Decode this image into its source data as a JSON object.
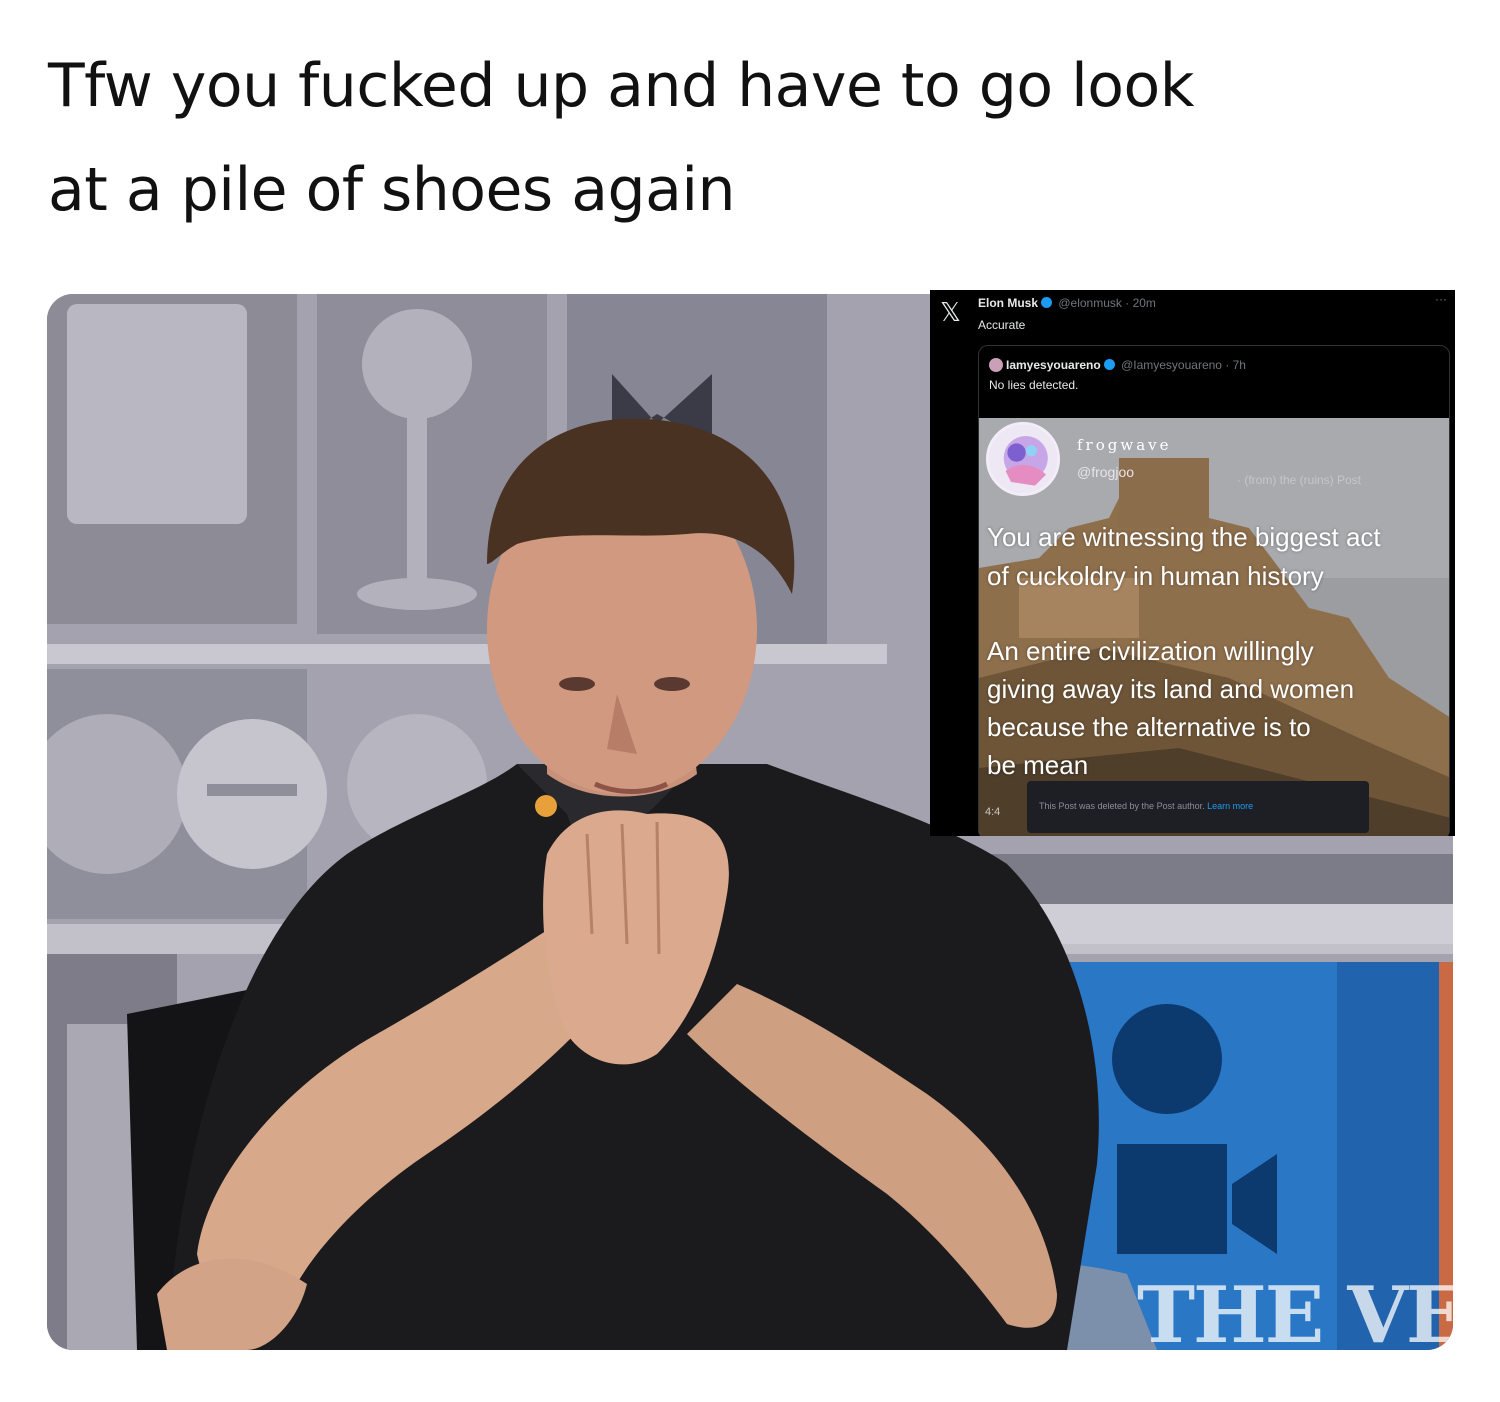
{
  "post": {
    "line1": "Tfw you fucked up and have to go look",
    "line2": "at a pile of shoes again"
  },
  "media": {
    "watermark": "THE VERG",
    "embedded_tweet": {
      "author": "Elon Musk",
      "handle_meta": "@elonmusk · 20m",
      "text": "Accurate",
      "more": "···",
      "quoted": {
        "author": "Iamyesyouareno",
        "handle_meta": "@Iamyesyouareno · 7h",
        "text": "No lies detected.",
        "inner": {
          "name": "frogwave",
          "handle": "@frogjoo",
          "faded_text": "· (from) the (ruins) Post",
          "text_line1": "You are witnessing the biggest act",
          "text_line2": "of cuckoldry in human history",
          "text_line3": "An entire civilization willingly",
          "text_line4": "giving away its land and women",
          "text_line5": "because the alternative is to",
          "text_line6": "be mean",
          "stamp": "4:4",
          "deleted_notice": "This Post was deleted by the Post author.",
          "learn_more": "Learn more"
        }
      }
    }
  },
  "colors": {
    "verified": "#1d9bf0",
    "tweet_bg": "#000000",
    "shirt": "#1b1a1d"
  },
  "icons": {
    "x_logo": "x-logo-icon",
    "verified": "verified-badge-icon"
  }
}
